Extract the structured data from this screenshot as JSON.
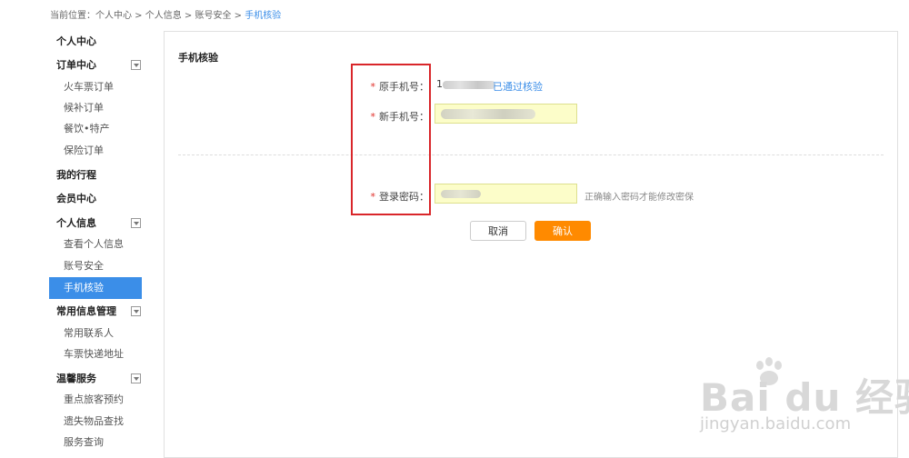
{
  "breadcrumb": {
    "prefix": "当前位置：",
    "items": [
      "个人中心",
      "个人信息",
      "账号安全"
    ],
    "separator": " > ",
    "current": "手机核验"
  },
  "sidebar": {
    "items": [
      {
        "label": "个人中心",
        "type": "head"
      },
      {
        "label": "订单中心",
        "type": "head",
        "collapsible": true
      },
      {
        "label": "火车票订单",
        "type": "sub"
      },
      {
        "label": "候补订单",
        "type": "sub"
      },
      {
        "label": "餐饮•特产",
        "type": "sub"
      },
      {
        "label": "保险订单",
        "type": "sub"
      },
      {
        "label": "我的行程",
        "type": "head"
      },
      {
        "label": "会员中心",
        "type": "head"
      },
      {
        "label": "个人信息",
        "type": "head",
        "collapsible": true
      },
      {
        "label": "查看个人信息",
        "type": "sub"
      },
      {
        "label": "账号安全",
        "type": "sub"
      },
      {
        "label": "手机核验",
        "type": "sub",
        "active": true
      },
      {
        "label": "常用信息管理",
        "type": "head",
        "collapsible": true
      },
      {
        "label": "常用联系人",
        "type": "sub"
      },
      {
        "label": "车票快递地址",
        "type": "sub"
      },
      {
        "label": "温馨服务",
        "type": "head",
        "collapsible": true
      },
      {
        "label": "重点旅客预约",
        "type": "sub"
      },
      {
        "label": "遗失物品查找",
        "type": "sub"
      },
      {
        "label": "服务查询",
        "type": "sub"
      }
    ]
  },
  "form": {
    "title": "手机核验",
    "required_mark": "*",
    "original_phone_label": "原手机号：",
    "original_phone_visible": "1",
    "verified_link": "已通过核验",
    "new_phone_label": "新手机号：",
    "new_phone_value": "",
    "password_label": "登录密码：",
    "password_value": "",
    "password_hint": "正确输入密码才能修改密保"
  },
  "buttons": {
    "cancel": "取消",
    "confirm": "确认"
  },
  "watermark": {
    "logo": "Bai du 经验",
    "url": "jingyan.baidu.com"
  },
  "colors": {
    "accent": "#3b8ee8",
    "confirm": "#ff8a00",
    "required": "#e0302a",
    "highlight_box": "#d9262a",
    "input_bg": "#fcfdc9"
  }
}
